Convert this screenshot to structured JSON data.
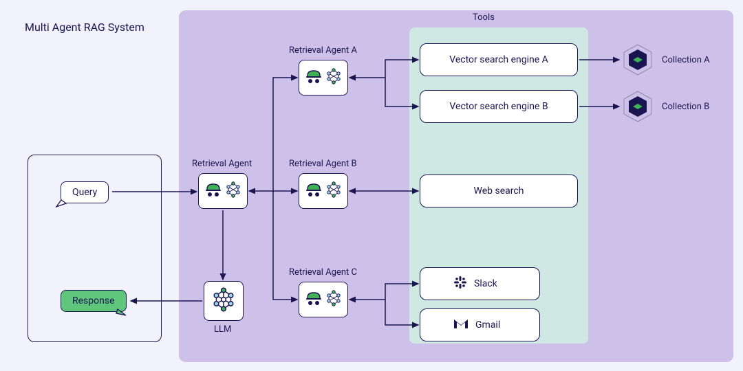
{
  "title": "Multi Agent RAG System",
  "client": {
    "query": "Query",
    "response": "Response"
  },
  "retrieval_agent": {
    "label": "Retrieval Agent"
  },
  "agents": {
    "a": {
      "label": "Retrieval Agent A"
    },
    "b": {
      "label": "Retrieval Agent B"
    },
    "c": {
      "label": "Retrieval Agent C"
    }
  },
  "llm": {
    "label": "LLM"
  },
  "tools": {
    "heading": "Tools",
    "vsa": "Vector search engine A",
    "vsb": "Vector search engine B",
    "web": "Web search",
    "slack": "Slack",
    "gmail": "Gmail"
  },
  "collections": {
    "a": "Collection A",
    "b": "Collection B"
  },
  "colors": {
    "bg": "#f1f2fb",
    "purple": "#cec1e9",
    "teal": "#d0e8e4",
    "stroke": "#1a1550",
    "green": "#5fc77c"
  }
}
